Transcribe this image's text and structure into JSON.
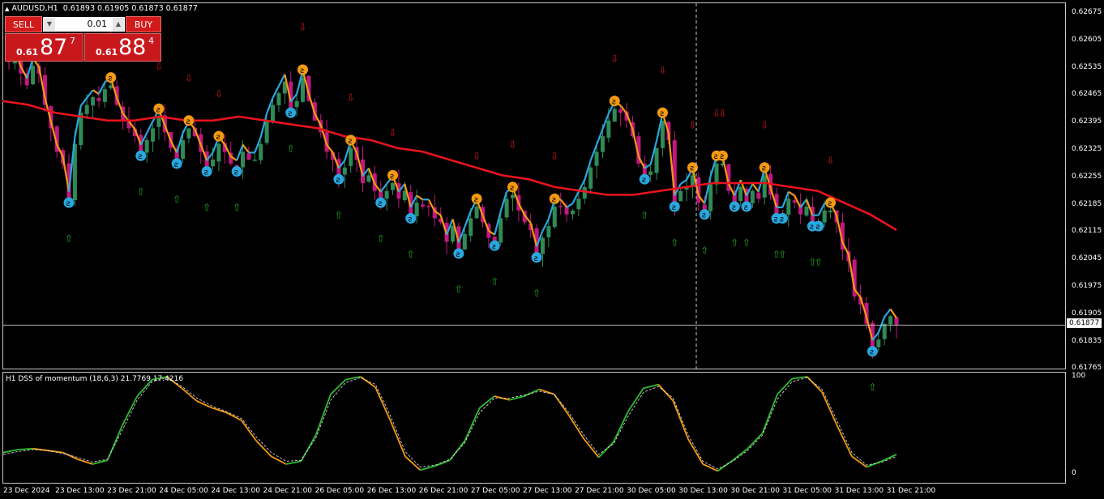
{
  "chart": {
    "symbol": "AUDUSD,H1",
    "ohlc_text": "0.61893 0.61905 0.61873 0.61877",
    "current_price": "0.61877",
    "indicator_label": "H1 DSS of momentum (18,6,3) 21.7769 17.4216",
    "colors": {
      "bull_candle": "#2e8b57",
      "bear_candle": "#c2187f",
      "ma": "#e8141c",
      "trail_up": "#29a8e0",
      "trail_down": "#f39a12",
      "arrow_up": "#1fa51f",
      "arrow_down": "#d11515",
      "dss_main_up": "#2ebd2e",
      "dss_main_down": "#f39a12"
    }
  },
  "trade_panel": {
    "sell_label": "SELL",
    "buy_label": "BUY",
    "lot": "0.01",
    "sell_price_small": "0.61",
    "sell_price_big": "87",
    "sell_price_sup": "7",
    "buy_price_small": "0.61",
    "buy_price_big": "88",
    "buy_price_sup": "4"
  },
  "price_axis": [
    "0.62675",
    "0.62605",
    "0.62535",
    "0.62465",
    "0.62395",
    "0.62325",
    "0.62255",
    "0.62185",
    "0.62115",
    "0.62045",
    "0.61975",
    "0.61905",
    "0.61835",
    "0.61765"
  ],
  "indicator_axis": [
    "100",
    "0"
  ],
  "time_axis": [
    "23 Dec 2024",
    "23 Dec 13:00",
    "23 Dec 21:00",
    "24 Dec 05:00",
    "24 Dec 13:00",
    "24 Dec 21:00",
    "26 Dec 05:00",
    "26 Dec 13:00",
    "26 Dec 21:00",
    "27 Dec 05:00",
    "27 Dec 13:00",
    "27 Dec 21:00",
    "30 Dec 05:00",
    "30 Dec 13:00",
    "30 Dec 21:00",
    "31 Dec 05:00",
    "31 Dec 13:00",
    "31 Dec 21:00"
  ],
  "chart_data": {
    "type": "candlestick",
    "ylim": [
      0.61765,
      0.62675
    ],
    "close_series": [
      0.6255,
      0.6256,
      0.6252,
      0.6249,
      0.6254,
      0.6252,
      0.6244,
      0.6238,
      0.6232,
      0.6229,
      0.622,
      0.6234,
      0.6242,
      0.6244,
      0.6246,
      0.6245,
      0.6248,
      0.6249,
      0.6244,
      0.624,
      0.6238,
      0.6236,
      0.6232,
      0.6235,
      0.6238,
      0.6241,
      0.6237,
      0.6233,
      0.623,
      0.6235,
      0.6238,
      0.6236,
      0.6232,
      0.6228,
      0.623,
      0.6234,
      0.6232,
      0.6229,
      0.6228,
      0.6232,
      0.623,
      0.623,
      0.6234,
      0.624,
      0.6244,
      0.6247,
      0.625,
      0.6243,
      0.6245,
      0.6251,
      0.6245,
      0.624,
      0.6237,
      0.6232,
      0.623,
      0.6226,
      0.6228,
      0.6233,
      0.623,
      0.6224,
      0.6226,
      0.6222,
      0.622,
      0.6222,
      0.6224,
      0.622,
      0.6222,
      0.6216,
      0.6219,
      0.6218,
      0.6218,
      0.6215,
      0.6214,
      0.6209,
      0.6213,
      0.6207,
      0.6211,
      0.6215,
      0.6218,
      0.6214,
      0.621,
      0.6209,
      0.6215,
      0.622,
      0.6221,
      0.6217,
      0.6214,
      0.6212,
      0.6206,
      0.621,
      0.6213,
      0.6218,
      0.6218,
      0.6216,
      0.6217,
      0.622,
      0.6223,
      0.6228,
      0.6232,
      0.6236,
      0.624,
      0.6243,
      0.6242,
      0.624,
      0.6236,
      0.6229,
      0.6226,
      0.6227,
      0.6233,
      0.624,
      0.6235,
      0.6219,
      0.6222,
      0.6223,
      0.6226,
      0.6219,
      0.6217,
      0.6224,
      0.6229,
      0.6229,
      0.6222,
      0.6219,
      0.6223,
      0.6219,
      0.6222,
      0.622,
      0.6226,
      0.6221,
      0.6216,
      0.6216,
      0.622,
      0.6219,
      0.6216,
      0.6218,
      0.6214,
      0.6214,
      0.6217,
      0.6217,
      0.6214,
      0.6207,
      0.6204,
      0.6195,
      0.6193,
      0.6188,
      0.6182,
      0.6184,
      0.6188,
      0.619,
      0.61877
    ],
    "ma_series": [
      0.6245,
      0.6244,
      0.6242,
      0.6241,
      0.624,
      0.624,
      0.6241,
      0.624,
      0.624,
      0.6241,
      0.624,
      0.6239,
      0.6238,
      0.6236,
      0.6235,
      0.6233,
      0.6232,
      0.623,
      0.6228,
      0.6226,
      0.6225,
      0.6223,
      0.6222,
      0.6221,
      0.6221,
      0.6222,
      0.6223,
      0.6224,
      0.6224,
      0.6224,
      0.6223,
      0.6222,
      0.6219,
      0.6216,
      0.6212
    ]
  },
  "dss_data": {
    "ylim": [
      0,
      100
    ],
    "main": [
      22,
      25,
      26,
      24,
      22,
      15,
      10,
      14,
      50,
      80,
      97,
      100,
      88,
      75,
      68,
      63,
      55,
      34,
      18,
      10,
      13,
      40,
      82,
      97,
      100,
      89,
      55,
      18,
      4,
      8,
      14,
      34,
      68,
      80,
      76,
      80,
      87,
      82,
      60,
      36,
      17,
      33,
      65,
      88,
      92,
      75,
      36,
      10,
      3,
      14,
      26,
      42,
      82,
      98,
      100,
      84,
      50,
      18,
      7,
      13,
      20
    ],
    "signal": [
      20,
      23,
      25,
      24,
      21,
      17,
      12,
      15,
      45,
      76,
      95,
      99,
      90,
      78,
      70,
      64,
      57,
      38,
      22,
      13,
      14,
      37,
      76,
      94,
      99,
      92,
      60,
      23,
      7,
      9,
      15,
      32,
      63,
      78,
      78,
      81,
      85,
      82,
      63,
      40,
      20,
      31,
      60,
      84,
      90,
      78,
      40,
      13,
      5,
      13,
      24,
      40,
      77,
      95,
      99,
      87,
      55,
      22,
      9,
      12,
      18
    ]
  }
}
